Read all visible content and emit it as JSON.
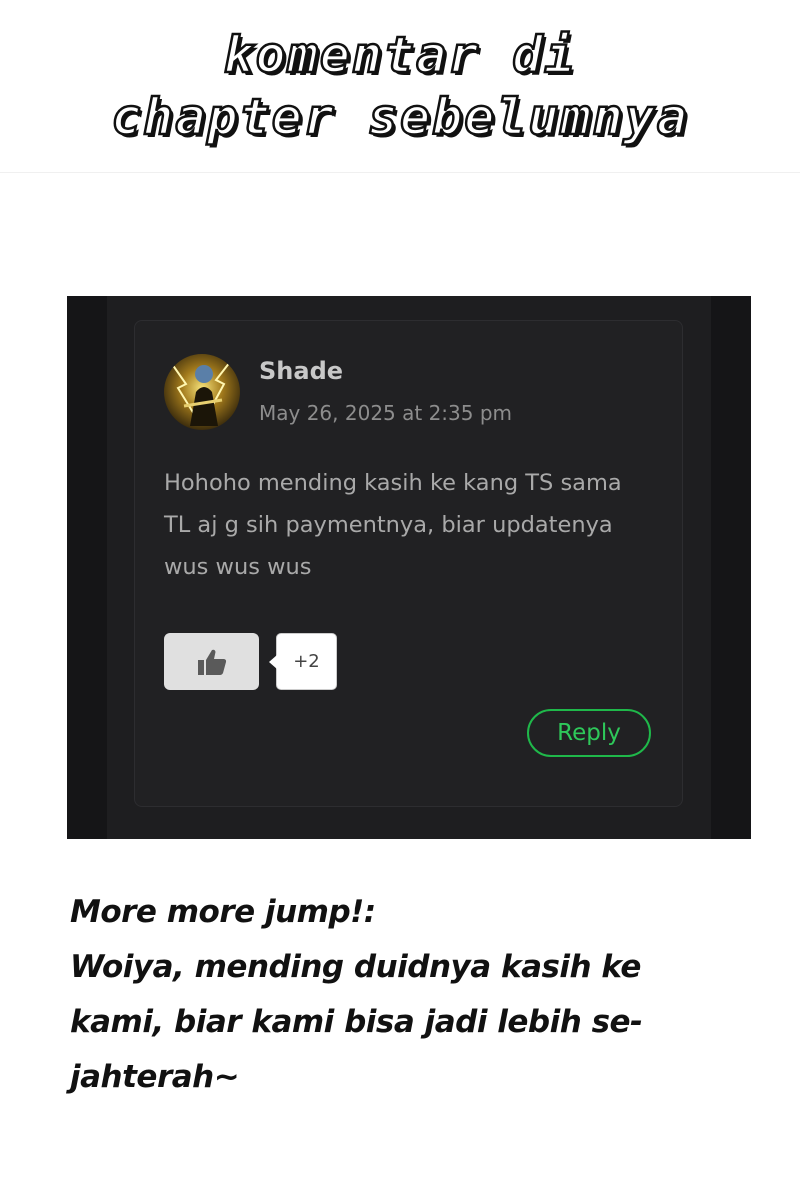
{
  "header": {
    "title_lines": [
      "komentar di",
      "chapter sebelumnya"
    ]
  },
  "comment": {
    "author": "Shade",
    "date": "May 26, 2025 at 2:35 pm",
    "text_lines": [
      "Hohoho mending kasih ke kang TS sama",
      "TL aj g sih paymentnya, biar updatenya",
      "wus wus wus"
    ],
    "like_count": "+2",
    "reply_label": "Reply",
    "avatar_icon": "avatar-image",
    "like_icon": "thumbs-up-icon",
    "accent_color": "#1fb84a"
  },
  "response": {
    "lines": [
      "More more jump!:",
      "Woiya, mending duidnya kasih ke",
      "kami, biar kami bisa jadi lebih se-",
      "jahterah~"
    ]
  }
}
